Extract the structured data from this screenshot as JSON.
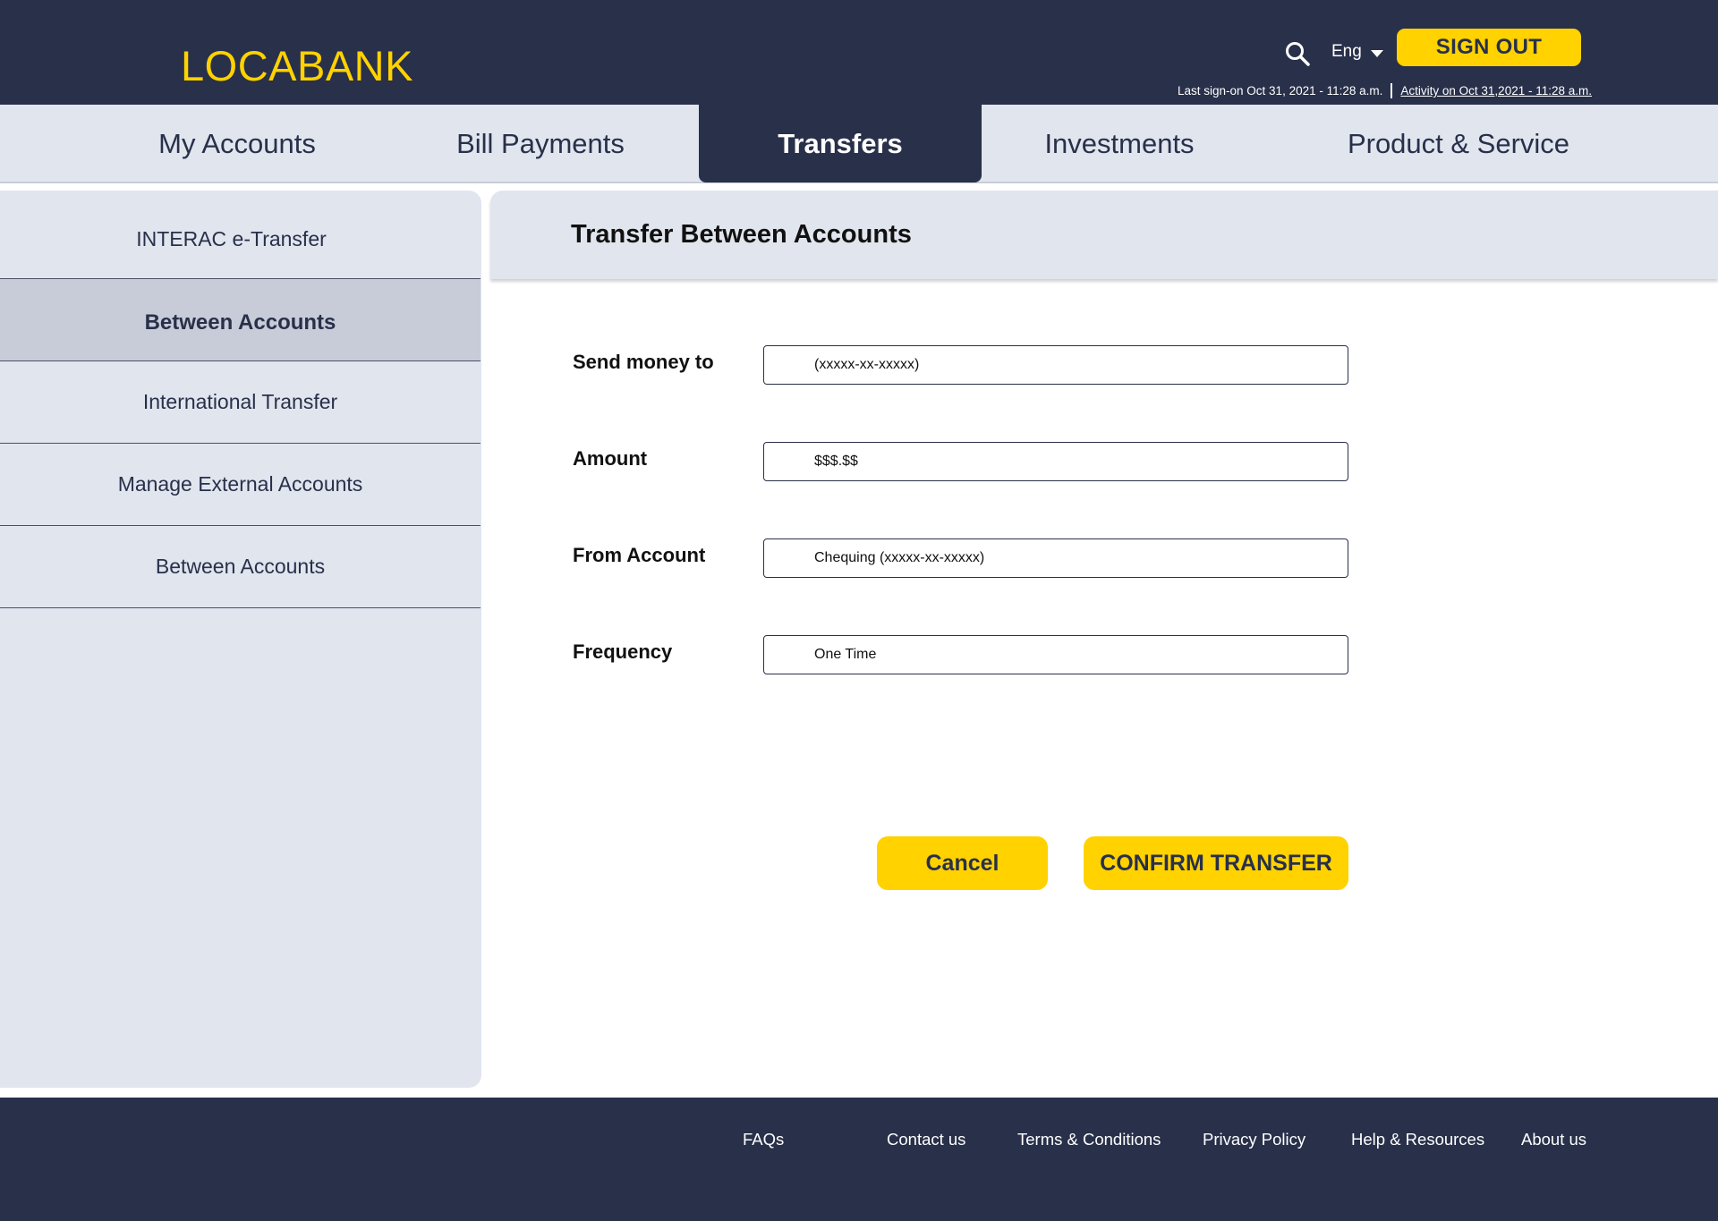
{
  "header": {
    "logo": "LOCABANK",
    "search_icon": "search-icon",
    "language": "Eng",
    "language_icon": "chevron-down-icon",
    "signout_label": "SIGN OUT",
    "last_signon": "Last sign-on Oct 31, 2021 - 11:28 a.m.",
    "activity_link": "Activity on Oct 31,2021 - 11:28 a.m.",
    "colors": {
      "background": "#28304a",
      "accent": "#ffd200"
    }
  },
  "nav": {
    "items": [
      {
        "label": "My Accounts"
      },
      {
        "label": "Bill Payments"
      },
      {
        "label": "Transfers",
        "active": true
      },
      {
        "label": "Investments"
      },
      {
        "label": "Product & Service"
      }
    ]
  },
  "sidebar": {
    "items": [
      {
        "label": "INTERAC e-Transfer"
      },
      {
        "label": "Between Accounts",
        "active": true
      },
      {
        "label": "International Transfer"
      },
      {
        "label": "Manage External Accounts"
      },
      {
        "label": "Between Accounts"
      }
    ]
  },
  "content": {
    "title": "Transfer Between Accounts",
    "fields": [
      {
        "label": "Send money to",
        "value": "(xxxxx-xx-xxxxx)"
      },
      {
        "label": "Amount",
        "value": "$$$.$$"
      },
      {
        "label": "From Account",
        "value": "Chequing (xxxxx-xx-xxxxx)"
      },
      {
        "label": "Frequency",
        "value": "One Time"
      }
    ],
    "cancel_label": "Cancel",
    "confirm_label": "CONFIRM TRANSFER"
  },
  "footer": {
    "links": [
      {
        "label": "FAQs"
      },
      {
        "label": "Contact us"
      },
      {
        "label": "Terms & Conditions"
      },
      {
        "label": "Privacy Policy"
      },
      {
        "label": "Help & Resources"
      },
      {
        "label": "About us"
      }
    ]
  }
}
